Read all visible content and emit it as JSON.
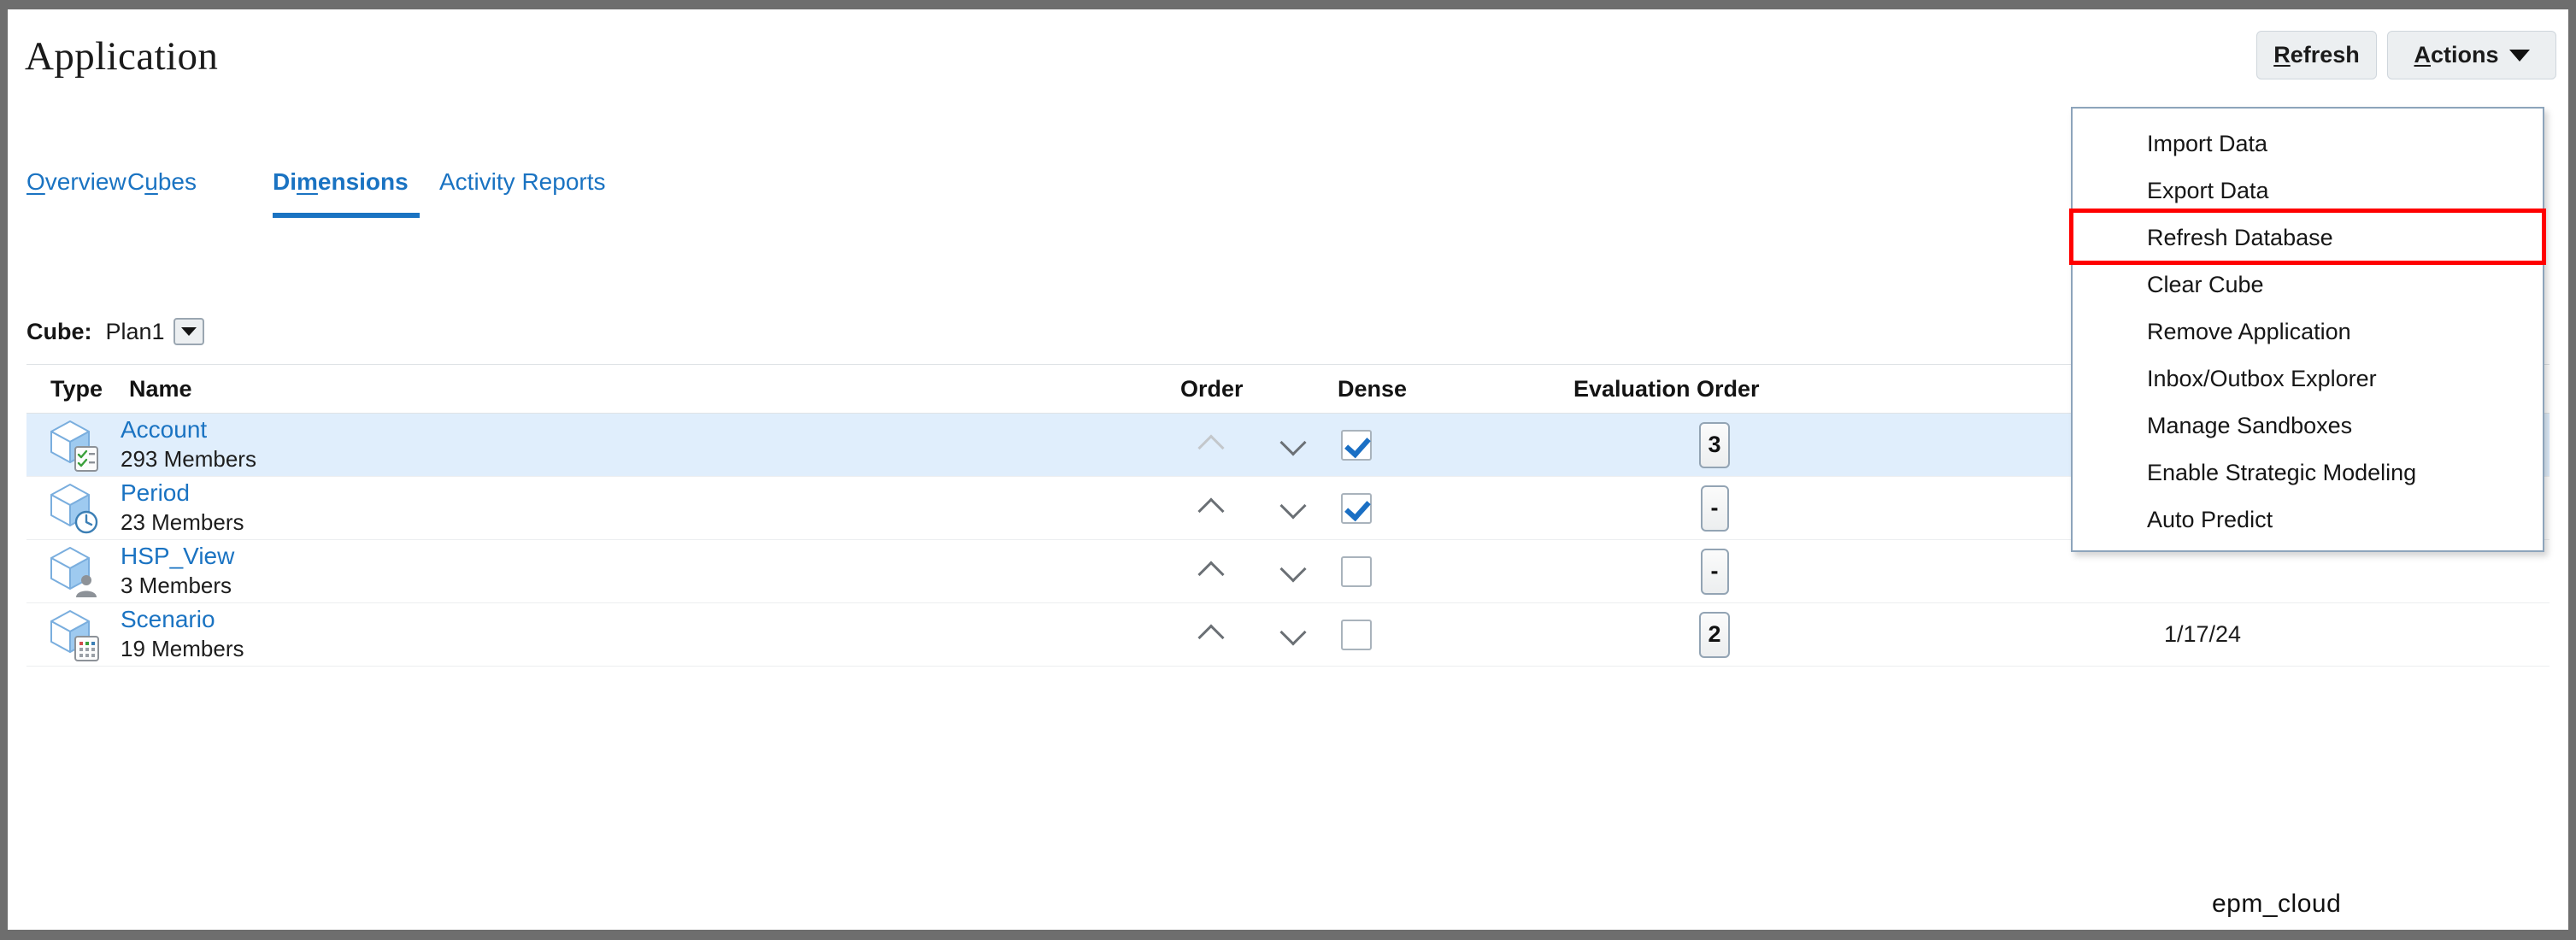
{
  "header": {
    "title": "Application",
    "refresh_label": "Refresh",
    "refresh_mnemonic": "R",
    "refresh_rest": "efresh",
    "actions_label": "Actions",
    "actions_mnemonic": "A",
    "actions_rest": "ctions"
  },
  "tabs": [
    {
      "label": "Overview",
      "mnemonic": "O",
      "pre": "",
      "post": "verview",
      "active": false
    },
    {
      "label": "Cubes",
      "mnemonic": "u",
      "pre": "C",
      "post": "bes",
      "active": false
    },
    {
      "label": "Dimensions",
      "mnemonic": "m",
      "pre": "Di",
      "post": "ensions",
      "active": true
    },
    {
      "label": "Activity Reports",
      "mnemonic": "",
      "pre": "Activity Reports",
      "post": "",
      "active": false
    }
  ],
  "actions_menu": {
    "items": [
      {
        "label": "Import Data",
        "highlighted": false
      },
      {
        "label": "Export Data",
        "highlighted": false
      },
      {
        "label": "Refresh Database",
        "highlighted": true
      },
      {
        "label": "Clear Cube",
        "highlighted": false
      },
      {
        "label": "Remove Application",
        "highlighted": false
      },
      {
        "label": "Inbox/Outbox Explorer",
        "highlighted": false
      },
      {
        "label": "Manage Sandboxes",
        "highlighted": false
      },
      {
        "label": "Enable Strategic Modeling",
        "highlighted": false
      },
      {
        "label": "Auto Predict",
        "highlighted": false
      }
    ],
    "highlight_color": "#ff0000"
  },
  "cube_selector": {
    "label": "Cube:",
    "value": "Plan1"
  },
  "table": {
    "columns": [
      "Type",
      "Name",
      "Order",
      "Dense",
      "Evaluation Order"
    ],
    "rows": [
      {
        "icon": "cube-checklist-icon",
        "name": "Account",
        "members": "293 Members",
        "order_up_enabled": false,
        "dense": true,
        "evaluation_order": "3",
        "date": "",
        "selected": true
      },
      {
        "icon": "cube-clock-icon",
        "name": "Period",
        "members": "23 Members",
        "order_up_enabled": true,
        "dense": true,
        "evaluation_order": "-",
        "date": "",
        "selected": false
      },
      {
        "icon": "cube-person-icon",
        "name": "HSP_View",
        "members": "3 Members",
        "order_up_enabled": true,
        "dense": false,
        "evaluation_order": "-",
        "date": "",
        "selected": false
      },
      {
        "icon": "cube-grid-icon",
        "name": "Scenario",
        "members": "19 Members",
        "order_up_enabled": true,
        "dense": false,
        "evaluation_order": "2",
        "date": "1/17/24",
        "selected": false
      }
    ]
  },
  "watermark": {
    "text": "epm_cloud"
  },
  "colors": {
    "link": "#1a73c2",
    "selected_row": "#e0eefc",
    "accent": "#1a6fc4",
    "highlight": "#ff0000"
  }
}
